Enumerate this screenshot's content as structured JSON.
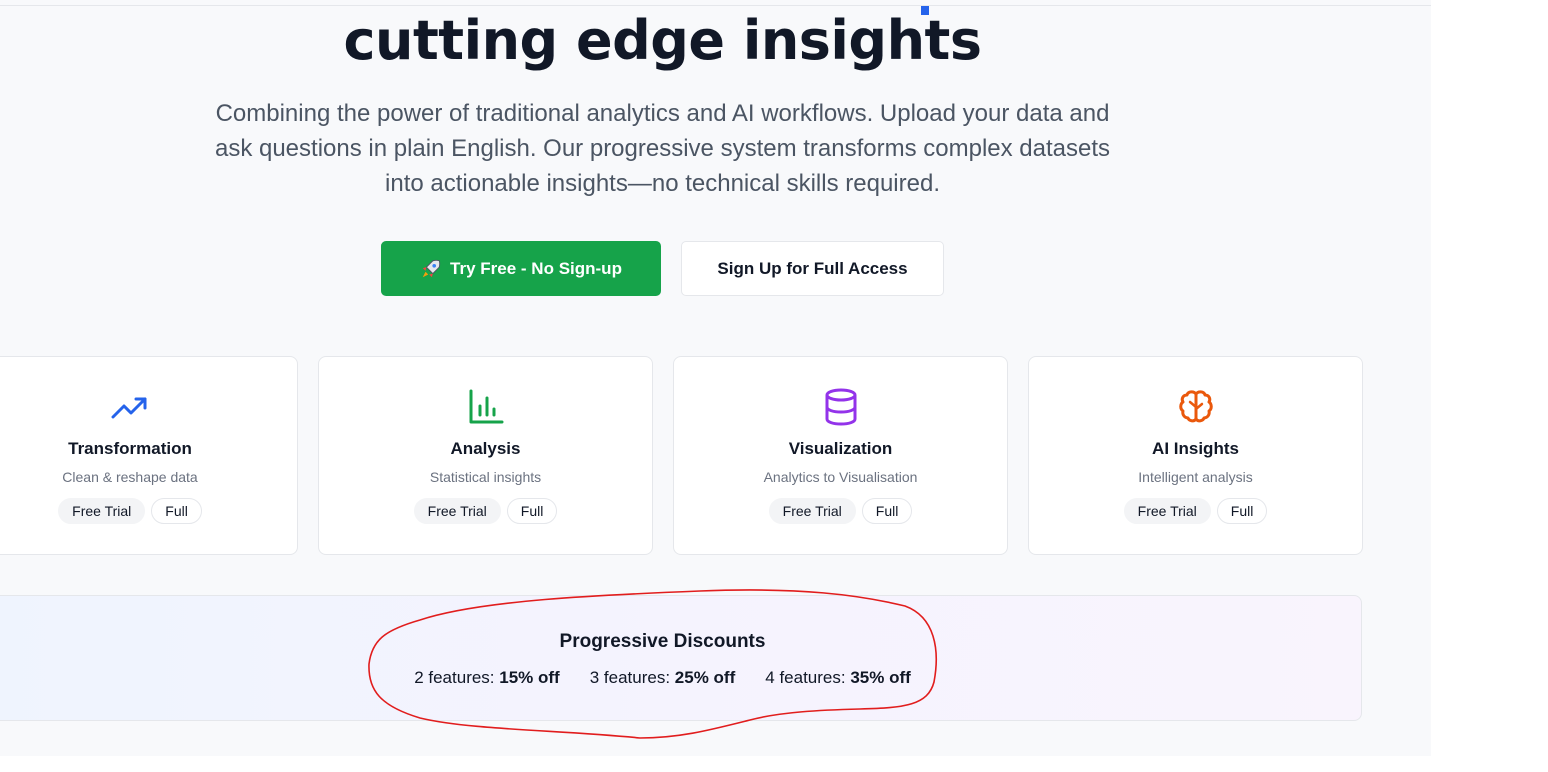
{
  "hero": {
    "title": "cutting edge insights",
    "subtitle_lines": [
      "Combining the power of traditional analytics and AI workflows. Upload your data and",
      "ask questions in plain English. Our progressive system transforms complex datasets",
      "into actionable insights—no technical skills required."
    ]
  },
  "cta": {
    "primary_label": "Try Free - No Sign-up",
    "primary_icon": "rocket-icon",
    "secondary_label": "Sign Up for Full Access"
  },
  "features": [
    {
      "title": "Transformation",
      "description": "Clean & reshape data",
      "icon": "trending-up-icon",
      "color": "#2563eb",
      "chips": [
        "Free Trial",
        "Full"
      ]
    },
    {
      "title": "Analysis",
      "description": "Statistical insights",
      "icon": "bar-chart-icon",
      "color": "#16a34a",
      "chips": [
        "Free Trial",
        "Full"
      ]
    },
    {
      "title": "Visualization",
      "description": "Analytics to Visualisation",
      "icon": "database-icon",
      "color": "#9333ea",
      "chips": [
        "Free Trial",
        "Full"
      ]
    },
    {
      "title": "AI Insights",
      "description": "Intelligent analysis",
      "icon": "brain-icon",
      "color": "#ea580c",
      "chips": [
        "Free Trial",
        "Full"
      ]
    }
  ],
  "discounts": {
    "title": "Progressive Discounts",
    "tiers": [
      {
        "label": "2 features:",
        "value": "15% off"
      },
      {
        "label": "3 features:",
        "value": "25% off"
      },
      {
        "label": "4 features:",
        "value": "35% off"
      }
    ]
  },
  "annotation": {
    "color": "#e11d1d",
    "shape": "hand-drawn circle around Progressive Discounts"
  }
}
